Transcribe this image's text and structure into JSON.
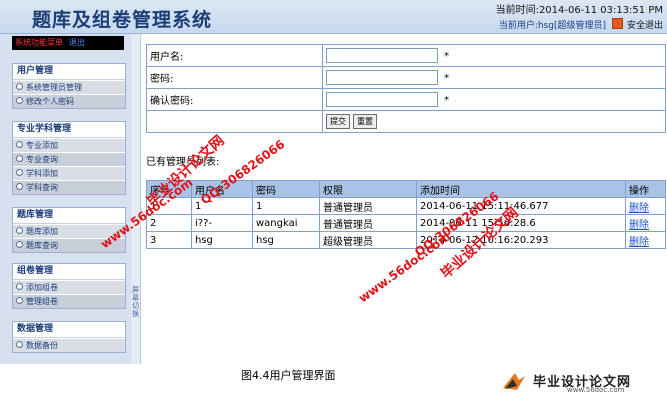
{
  "header": {
    "title": "题库及组卷管理系统",
    "time": "当前时间:2014-06-11 03:13:51 PM",
    "current_user": "当前用户:hsg[超级管理员]",
    "logout": "安全退出"
  },
  "sidebar": {
    "menu_title": "系统功能菜单",
    "menu_exit": "退出",
    "groups": [
      {
        "title": "用户管理",
        "items": [
          "系统管理员管理",
          "修改个人密码"
        ]
      },
      {
        "title": "专业学科管理",
        "items": [
          "专业添加",
          "专业查询",
          "学科添加",
          "学科查询"
        ]
      },
      {
        "title": "题库管理",
        "items": [
          "题库添加",
          "题库查询"
        ]
      },
      {
        "title": "组卷管理",
        "items": [
          "添加组卷",
          "管理组卷"
        ]
      },
      {
        "title": "数据管理",
        "items": [
          "数据备份"
        ]
      }
    ],
    "handle_label": "屏幕切换"
  },
  "form": {
    "username_label": "用户名:",
    "password_label": "密码:",
    "confirm_label": "确认密码:",
    "required_mark": "*",
    "submit": "提交",
    "reset": "重置"
  },
  "list": {
    "title": "已有管理员列表:",
    "columns": [
      "序号",
      "用户名",
      "密码",
      "权限",
      "添加时间",
      "操作"
    ],
    "rows": [
      [
        "1",
        "1",
        "1",
        "普通管理员",
        "2014-06-11 15:11:46.677",
        "删除"
      ],
      [
        "2",
        "i??-",
        "wangkai",
        "普通管理员",
        "2014-06-11 15:56:28.6",
        "删除"
      ],
      [
        "3",
        "hsg",
        "hsg",
        "超级管理员",
        "2014-06-12 10:16:20.293",
        "删除"
      ]
    ]
  },
  "caption": "图4.4用户管理界面",
  "watermarks": {
    "site_cn": "毕业设计论文网",
    "site_url": "www.56doc.com",
    "qq": "QQ:306826066"
  },
  "logo": {
    "text": "毕业设计论文网",
    "sub": "www.56doc.com"
  }
}
